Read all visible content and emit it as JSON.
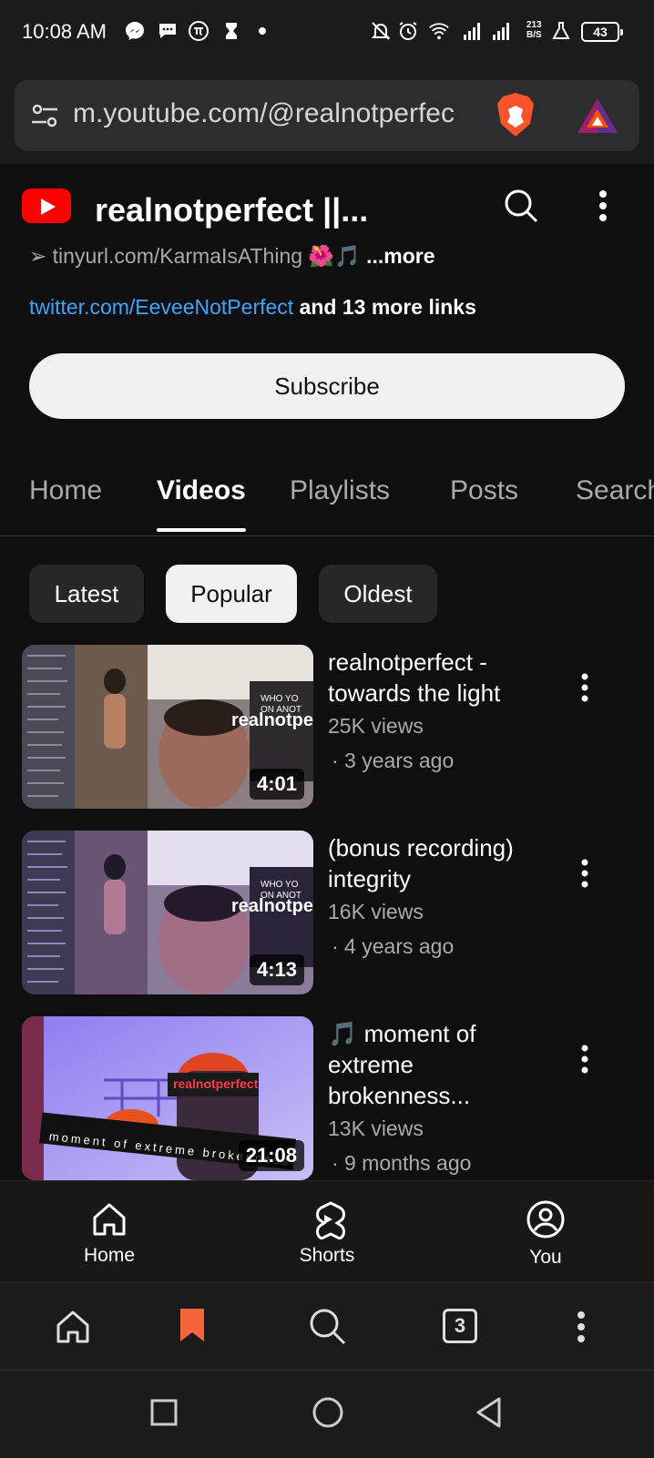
{
  "status_bar": {
    "time": "10:08 AM",
    "net_rate_value": "213",
    "net_rate_unit": "B/S",
    "battery": "43"
  },
  "browser": {
    "url": "m.youtube.com/@realnotperfec",
    "tab_count": "3",
    "accent": "#fb542b"
  },
  "channel": {
    "title": "realnotperfect ||...",
    "link1_text": "➢ tinyurl.com/KarmaIsAThing 🌺🎵",
    "link1_more": " ...more",
    "link2_url": "twitter.com/EeveeNotPerfect",
    "link2_more": " and 13 more links",
    "subscribe_label": "Subscribe"
  },
  "tabs": [
    "Home",
    "Videos",
    "Playlists",
    "Posts",
    "Search"
  ],
  "chips": [
    "Latest",
    "Popular",
    "Oldest"
  ],
  "videos": [
    {
      "title": "realnotperfect - towards the light",
      "views": "25K views",
      "age": "· 3 years ago",
      "duration": "4:01"
    },
    {
      "title": "(bonus recording) integrity",
      "views": "16K views",
      "age": "· 4 years ago",
      "duration": "4:13"
    },
    {
      "title": "🎵 moment of extreme brokenness...",
      "views": "13K views",
      "age": "· 9 months ago",
      "duration": "21:08",
      "thumb_text_1": "realnotperfect",
      "thumb_text_2": "moment of extreme brokenness"
    }
  ],
  "thumb_captions": {
    "big": "realnotpe",
    "who": "WHO YO",
    "on": "ON ANOT"
  },
  "yt_nav": {
    "home": "Home",
    "shorts": "Shorts",
    "you": "You"
  },
  "colors": {
    "yt_red": "#ff0000",
    "link_blue": "#3ea6ff",
    "bookmark_orange": "#f6643c"
  }
}
